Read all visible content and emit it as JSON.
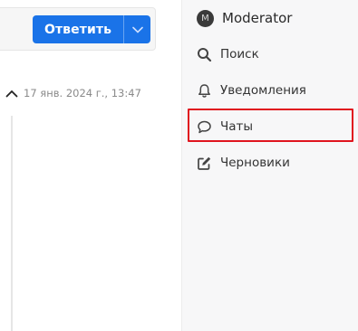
{
  "composer": {
    "reply_label": "Ответить",
    "icons": {
      "toggle": "chevron-down-icon"
    },
    "accent": "#1a73e8"
  },
  "timeline": {
    "date": "17 янв. 2024 г., 13:47",
    "icons": {
      "collapse": "chevron-up-icon"
    }
  },
  "sidebar": {
    "user": {
      "avatar_letter": "M",
      "name": "Moderator"
    },
    "items": [
      {
        "icon": "search-icon",
        "label": "Поиск"
      },
      {
        "icon": "bell-icon",
        "label": "Уведомления"
      },
      {
        "icon": "chat-icon",
        "label": "Чаты",
        "highlighted": true
      },
      {
        "icon": "pencil-square-icon",
        "label": "Черновики"
      }
    ],
    "highlight_color": "#e0141e"
  }
}
